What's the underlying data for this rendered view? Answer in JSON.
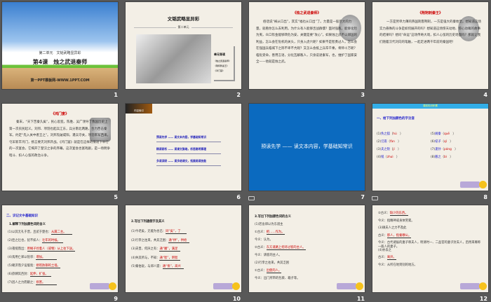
{
  "slides": [
    {
      "num": "1",
      "unit": "第二单元　文韬武略显异彩",
      "lesson": "第4课　烛之武退秦师",
      "site": "第一PPT模板网-WWW.1PPT.COM"
    },
    {
      "num": "2",
      "title": "文韬武略显异彩",
      "unit": "第二单元",
      "side_title": "单元导读",
      "side_items": [
        "《烛之武退秦师》",
        "《荆轲刺秦王》",
        "《鸿门宴》"
      ]
    },
    {
      "num": "3",
      "title": "《烛之武退秦师》",
      "body": "俗话说“祸从口出”，其实“福也从口出”了。力量是一股巨大的力量，就看你怎么去利用。为什么有人能够舌战群儒？面对强敌，能够化险为夷，众口铄金能够转危为安，关键是要“攻心”。如果烛之武不以郑国的利益，怎么会在危机的关头，只身入虎穴呢？如果不是智勇过人，怎么会在强国兵临城下之际不卑不亢呢？又怎么会抵上兵卒千乘，将师十万呢？临危受命，善用言语，分化瓦解敌人，只身说退秦军，也，维护了国家安全——他就是烛之武。"
    },
    {
      "num": "4",
      "title": "《荆轲刺秦王》",
      "body": "一方是势单力薄的燕国刺客荆轲，一方是强大的秦始皇。想知道这场实力悬殊的斗争是如何展开的吗？想知道这场惊天动地、惊心动魄的故事的结果吗？想问“命运”这场传奇大戏，扣人心弦的历史场面吗？那就让我们随着汉代刘向的笔触，一起走进两千年前的秦国吧！"
    },
    {
      "num": "5",
      "title": "《鸿门宴》",
      "body": "秦末，“天下苦秦久矣”，民心思变。陈胜、吴广领导了我国历史上第一次农民起义。刘邦、项羽也起兵江东，兵分南北两路，合力西击秦军。约定“先入关中者王之”。刘邦先破咸阳，遣兵守关，项羽率军西来，屯军新丰鸿门，扬言要灭刘邦开战。《鸿门宴》就是在这样的情况下举行的一次宴会，它揭开了楚汉之争的序幕。这次宴会也富戏剧，是一场明争暗斗、扣人心弦的政治斗争。"
    },
    {
      "num": "6",
      "banner": "内容索引",
      "links": [
        "预读先学 —— 读文本内容，学基础知常识",
        "精读研析 —— 读课文脉络，析思路明事理",
        "多读深研 —— 读多结课文，拓展阅读技能"
      ]
    },
    {
      "num": "7",
      "heading": "预读先学 —— 读文本内容，学基础知常识"
    },
    {
      "num": "8",
      "banner": "课前知识积累",
      "heading": "一、给下列加颜色的字注音",
      "items": [
        {
          "n": "(1)",
          "w": "佚之狐",
          "p": "hú"
        },
        {
          "n": "(5)",
          "w": "阙秦",
          "p": "quē"
        },
        {
          "n": "(2)",
          "w": "氾南",
          "p": "fàn"
        },
        {
          "n": "(6)",
          "w": "杞子",
          "p": "qǐ"
        },
        {
          "n": "(3)",
          "w": "夫之阨",
          "p": "jí"
        },
        {
          "n": "(7)",
          "w": "逢孙",
          "p": "páng"
        },
        {
          "n": "(4)",
          "w": "缒",
          "p": "zhuì"
        },
        {
          "n": "(8)",
          "w": "敝之",
          "p": "bì"
        }
      ]
    },
    {
      "num": "9",
      "heading": "二、识记文中基础知识",
      "sub": "1.解释下列加颜色词的含义",
      "items": [
        {
          "q": "(1)以其无礼于晋，且贰于楚也：",
          "a": "从属二主。"
        },
        {
          "q": "(2)臣之壮也，犹不如人：",
          "a": "壮年的时候。"
        },
        {
          "q": "(3)夜缒而出：",
          "a": "用绳子拴着人（或物）从上往下送。"
        },
        {
          "q": "(4)焉用亡郑以陪邻：",
          "a": "增加。"
        },
        {
          "q": "(5)朝济而夕设版焉：",
          "a": "修筑防御的土墙。"
        },
        {
          "q": "(6)欲肆其西封：",
          "a": "延伸、扩张。"
        },
        {
          "q": "(7)因人之力而敝之：",
          "a": "损害。"
        }
      ]
    },
    {
      "num": "10",
      "sub": "2.写出下列通假字及其义",
      "items": [
        {
          "q": "(1)今老矣，无能为也已：",
          "a": "同“矣”，了"
        },
        {
          "q": "(2)行李之往来，共其乏困：",
          "a": "通“供”，供给"
        },
        {
          "q": "(3)夫晋，何厌之有：",
          "a": "通“餍”，满足"
        },
        {
          "q": "(4)失其所与，不知：",
          "a": "通“智”，明智"
        },
        {
          "q": "(5)秦伯说，与郑人盟：",
          "a": "通“悦”，高兴"
        }
      ]
    },
    {
      "num": "11",
      "sub": "3.写出下列加颜色词的古义",
      "lines": [
        {
          "k": "(1)若舍郑以为东道主",
          "v": ""
        },
        {
          "k": "①古义：",
          "v": "把……作为。"
        },
        {
          "k": "今义：认为。",
          "v": ""
        },
        {
          "k": "②古义：",
          "v": "东方道路上招待过客的主人。"
        },
        {
          "k": "今义：请客的主人。",
          "v": ""
        },
        {
          "k": "(2)行李之往来，共其乏困",
          "v": ""
        },
        {
          "k": "①古义：",
          "v": "出使的人。"
        },
        {
          "k": "今义：出门所带的包裹、箱子等。",
          "v": ""
        }
      ]
    },
    {
      "num": "12",
      "lines": [
        {
          "k": "②古义：",
          "v": "缺少的东西。"
        },
        {
          "k": "今义：指精神或身体劳累。",
          "v": ""
        },
        {
          "k": "(3)微夫人之力不及此",
          "v": ""
        },
        {
          "k": "古义：",
          "v": "那人，指秦穆公。"
        },
        {
          "k": "今义：古代诸侯的妻子称夫人，明清时一、二品官的妻子封夫人，后用来尊称一般人的妻子。",
          "v": ""
        },
        {
          "k": "(4)亦去之",
          "v": ""
        },
        {
          "k": "古义：",
          "v": "离开。"
        },
        {
          "k": "今义：从所在地到别的地方。",
          "v": ""
        }
      ]
    }
  ]
}
